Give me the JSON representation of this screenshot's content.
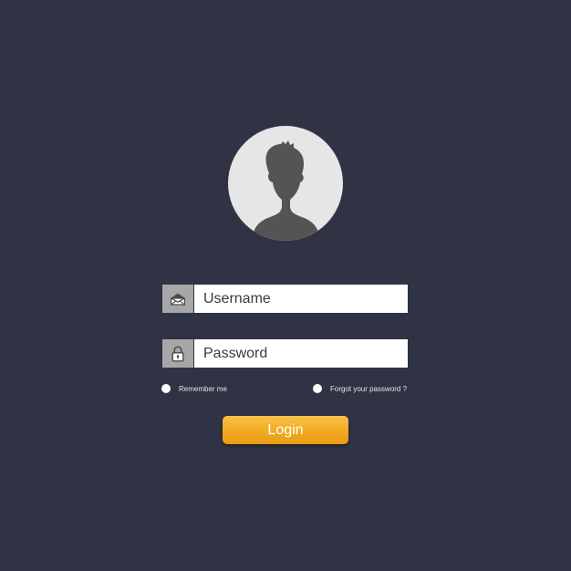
{
  "login_form": {
    "avatar_icon": "user-silhouette-icon",
    "username": {
      "icon": "envelope-icon",
      "placeholder": "Username",
      "value": ""
    },
    "password": {
      "icon": "lock-icon",
      "placeholder": "Password",
      "value": ""
    },
    "remember_label": "Remember me",
    "forgot_label": "Forgot your password ?",
    "login_label": "Login"
  },
  "colors": {
    "background": "#303344",
    "accent": "#f3aa22",
    "icon_box": "#a7a7a7",
    "avatar_bg": "#e6e6e6",
    "silhouette": "#545454"
  }
}
